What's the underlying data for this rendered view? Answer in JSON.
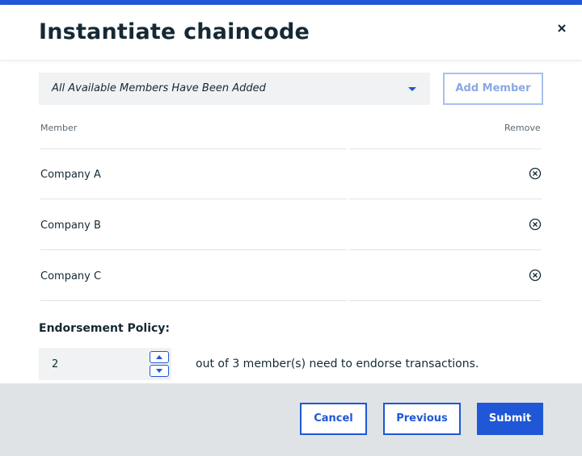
{
  "dialog": {
    "title": "Instantiate chaincode",
    "close_icon": "close-icon"
  },
  "members": {
    "select_value": "All Available Members Have Been Added",
    "add_button": "Add Member",
    "header_member": "Member",
    "header_remove": "Remove",
    "rows": [
      {
        "name": "Company A"
      },
      {
        "name": "Company B"
      },
      {
        "name": "Company C"
      }
    ]
  },
  "policy": {
    "label": "Endorsement Policy:",
    "value": "2",
    "text": "out of 3 member(s) need to endorse transactions."
  },
  "footer": {
    "cancel": "Cancel",
    "previous": "Previous",
    "submit": "Submit"
  },
  "colors": {
    "accent": "#1f57d6",
    "footer_bg": "#dfe3e6",
    "field_bg": "#f0f2f4"
  }
}
